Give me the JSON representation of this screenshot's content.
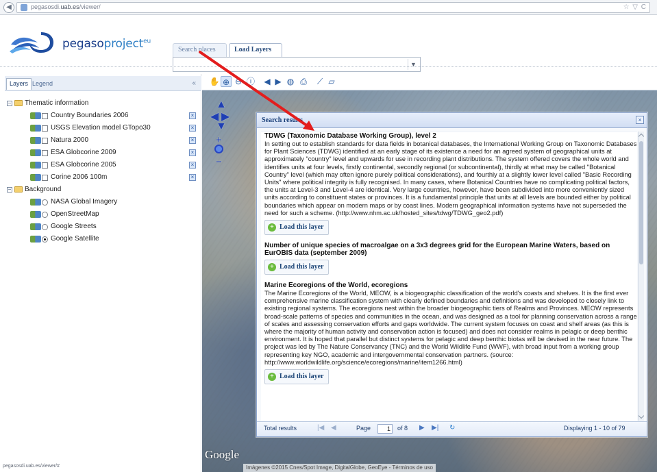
{
  "browser": {
    "url_prefix": "pegasosdi.",
    "url_domain": "uab.es",
    "url_suffix": "/viewer/",
    "actions": "☆ ▽ C"
  },
  "header": {
    "brand_main": "pegaso",
    "brand_tail": "project",
    "brand_sup": "eu"
  },
  "search_panel": {
    "tabs": [
      "Search places",
      "Load Layers"
    ],
    "active_tab": "Load Layers",
    "select_value": ""
  },
  "left_panel": {
    "tabs": [
      "Layers",
      "Legend"
    ],
    "collapse": "«",
    "groups": [
      {
        "label": "Thematic information",
        "items": [
          {
            "label": "Country Boundaries 2006",
            "control": "checkbox",
            "checked": false,
            "removable": true
          },
          {
            "label": "USGS Elevation model GTopo30",
            "control": "checkbox",
            "checked": false,
            "removable": true
          },
          {
            "label": "Natura 2000",
            "control": "checkbox",
            "checked": false,
            "removable": true
          },
          {
            "label": "ESA Globcorine 2009",
            "control": "checkbox",
            "checked": false,
            "removable": true
          },
          {
            "label": "ESA Globcorine 2005",
            "control": "checkbox",
            "checked": false,
            "removable": true
          },
          {
            "label": "Corine 2006 100m",
            "control": "checkbox",
            "checked": false,
            "removable": true
          }
        ]
      },
      {
        "label": "Background",
        "items": [
          {
            "label": "NASA Global Imagery",
            "control": "radio",
            "checked": false,
            "removable": false
          },
          {
            "label": "OpenStreetMap",
            "control": "radio",
            "checked": false,
            "removable": false
          },
          {
            "label": "Google Streets",
            "control": "radio",
            "checked": false,
            "removable": false
          },
          {
            "label": "Google Satellite",
            "control": "radio",
            "checked": true,
            "removable": false
          }
        ]
      }
    ]
  },
  "map": {
    "google_mark": "Google",
    "credits": "Imágenes ©2015 Cnes/Spot Image, DigitalGlobe, GeoEye - Términos de uso",
    "tools": [
      "pan-hand-icon",
      "zoom-in-icon",
      "zoom-out-icon",
      "info-icon",
      "previous-icon",
      "next-icon",
      "zoom-extent-icon",
      "print-icon",
      "measure-distance-icon",
      "measure-area-icon"
    ]
  },
  "results": {
    "title": "Search results",
    "items": [
      {
        "title": "TDWG (Taxonomic Database Working Group), level 2",
        "description": "In setting out to establish standards for data fields in botanical databases, the International Working Group on Taxonomic Databases for Plant Sciences (TDWG) identified at an early stage of its existence a need for an agreed system of geographical units at approximately \"country\" level and upwards for use in recording plant distributions. The system offered covers the whole world and identifies units at four levels, firstly continental, secondly regional (or subcontinental), thirdly at what may be called \"Botanical Country\" level (which may often ignore purely political considerations), and fourthly at a slightly lower level called \"Basic Recording Units\" where political integrity is fully recognised. In many cases, where Botanical Countries have no complicating political factors, the units at Level-3 and Level-4 are identical. Very large countries, however, have been subdivided into more conveniently sized units according to constituent states or provinces. It is a fundamental principle that units at all levels are bounded either by political boundaries which appear on modern maps or by coast lines. Modern geographical information systems have not superseded the need for such a scheme. (http://www.nhm.ac.uk/hosted_sites/tdwg/TDWG_geo2.pdf)",
        "button": "Load this layer"
      },
      {
        "title": "Number of unique species of macroalgae on a 3x3 degrees grid for the European Marine Waters, based on EurOBIS data (september 2009)",
        "description": "",
        "button": "Load this layer"
      },
      {
        "title": "Marine Ecoregions of the World, ecoregions",
        "description": "The Marine Ecoregions of the World, MEOW, is a biogeographic classification of the world's coasts and shelves. It is the first ever comprehensive marine classification system with clearly defined boundaries and definitions and was developed to closely link to existing regional systems. The ecoregions nest within the broader biogeographic tiers of Realms and Provinces. MEOW represents broad-scale patterns of species and communities in the ocean, and was designed as a tool for planning conservation across a range of scales and assessing conservation efforts and gaps worldwide. The current system focuses on coast and shelf areas (as this is where the majority of human activity and conservation action is focused) and does not consider realms in pelagic or deep benthic environment. It is hoped that parallel but distinct systems for pelagic and deep benthic biotas will be devised in the near future. The project was led by The Nature Conservancy (TNC) and the World Wildlife Fund (WWF), with broad input from a working group representing key NGO, academic and intergovernmental conservation partners. (source: http://www.worldwildlife.org/science/ecoregions/marine/item1266.html)",
        "button": "Load this layer"
      }
    ],
    "footer": {
      "total_label": "Total results",
      "page_label": "Page",
      "page_value": "1",
      "of_label": "of 8",
      "display_label": "Displaying 1 - 10 of 79"
    }
  },
  "status_bar": {
    "text": "pegasosdi.uab.es/viewer/#"
  },
  "colors": {
    "brand": "#1c3f8b",
    "accent": "#2f7fc5",
    "annotation_arrow": "#e31d1d",
    "panel_border": "#8ea6cf"
  }
}
